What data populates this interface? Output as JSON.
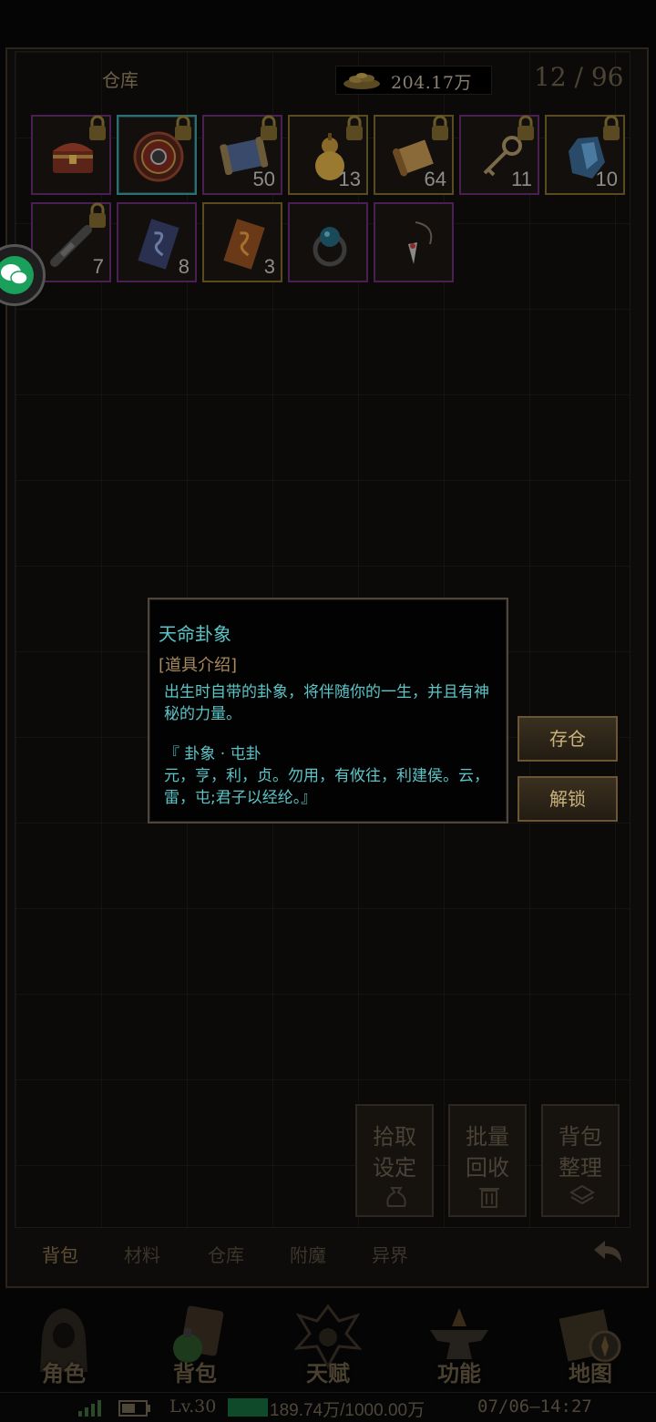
{
  "header": {
    "title": "仓库",
    "coins": "204.17万",
    "capacity": "12 / 96"
  },
  "slots_row1": [
    {
      "name": "treasure-chest",
      "count": "",
      "locked": true
    },
    {
      "name": "fate-trigram",
      "count": "",
      "locked": true
    },
    {
      "name": "blue-scroll",
      "count": "50",
      "locked": true
    },
    {
      "name": "gourd",
      "count": "13",
      "locked": true
    },
    {
      "name": "parchment-scroll",
      "count": "64",
      "locked": true
    },
    {
      "name": "key",
      "count": "11",
      "locked": true
    },
    {
      "name": "blue-crystal",
      "count": "10",
      "locked": true
    }
  ],
  "slots_row2": [
    {
      "name": "spyglass",
      "count": "7",
      "locked": true
    },
    {
      "name": "blue-talisman",
      "count": "8",
      "locked": false
    },
    {
      "name": "orange-talisman",
      "count": "3",
      "locked": false
    },
    {
      "name": "orb-ring",
      "count": "",
      "locked": false
    },
    {
      "name": "pendant",
      "count": "",
      "locked": false
    }
  ],
  "tooltip": {
    "title": "天命卦象",
    "section": "[道具介绍]",
    "desc": "出生时自带的卦象，将伴随你的一生，并且有神秘的力量。",
    "quote_line1": "『 卦象 · 屯卦",
    "quote_line2": "元，亨，利，贞。勿用，有攸往，利建侯。云，雷，屯;君子以经纶。』"
  },
  "side_buttons": {
    "store": "存仓",
    "unlock": "解锁"
  },
  "actions": {
    "pickup_l1": "拾取",
    "pickup_l2": "设定",
    "recycle_l1": "批量",
    "recycle_l2": "回收",
    "sort_l1": "背包",
    "sort_l2": "整理"
  },
  "tabs": [
    "背包",
    "材料",
    "仓库",
    "附魔",
    "异界"
  ],
  "nav": [
    "角色",
    "背包",
    "天赋",
    "功能",
    "地图"
  ],
  "status": {
    "level": "Lv.30",
    "exp": "189.74万/1000.00万",
    "time": "07/06—14:27"
  },
  "colors": {
    "tooltip_text": "#5cc5c8",
    "section_label": "#a88a5e",
    "button_text": "#c9b27c"
  }
}
